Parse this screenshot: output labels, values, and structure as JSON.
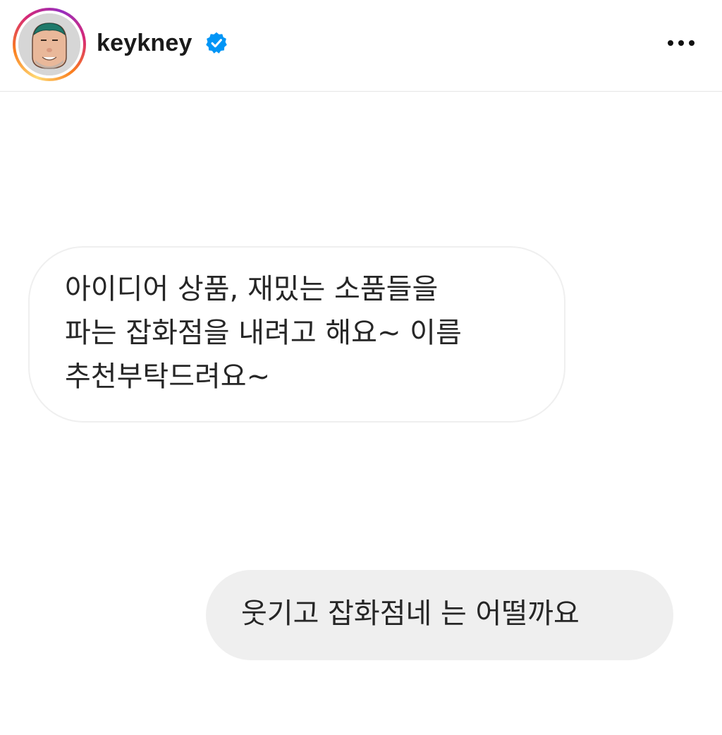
{
  "header": {
    "username": "keykney",
    "verified_badge_icon": "verified-badge-icon",
    "more_icon": "more-options-icon"
  },
  "messages": [
    {
      "direction": "received",
      "text": "아이디어 상품, 재밌는 소품들을\n파는 잡화점을 내려고 해요~ 이름\n추천부탁드려요~"
    },
    {
      "direction": "sent",
      "text": "웃기고 잡화점네 는 어떨까요"
    }
  ],
  "colors": {
    "verified_blue": "#0095f6",
    "received_bubble_border": "#efefef",
    "sent_bubble_bg": "#efefef",
    "ring_gradient": [
      "#feda75",
      "#fa7e1e",
      "#d62976",
      "#962fbf"
    ]
  }
}
